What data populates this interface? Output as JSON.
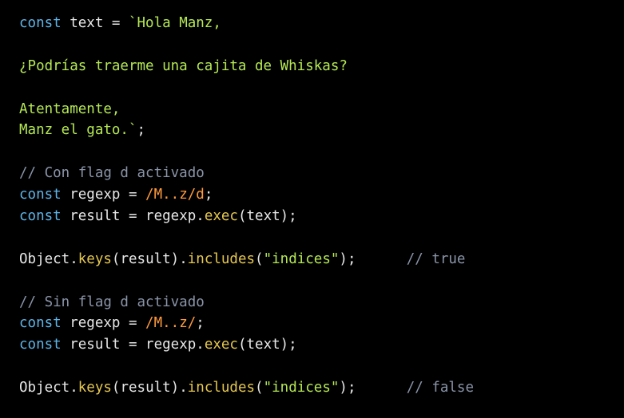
{
  "code": {
    "lines": [
      [
        {
          "t": "const",
          "c": "kw"
        },
        {
          "t": " text = ",
          "c": "id"
        },
        {
          "t": "`Hola Manz,",
          "c": "str"
        }
      ],
      [],
      [
        {
          "t": "¿Podrías traerme una cajita de Whiskas?",
          "c": "str"
        }
      ],
      [],
      [
        {
          "t": "Atentamente,",
          "c": "str"
        }
      ],
      [
        {
          "t": "Manz el gato.`",
          "c": "str"
        },
        {
          "t": ";",
          "c": "id"
        }
      ],
      [],
      [
        {
          "t": "// Con flag d activado",
          "c": "cm"
        }
      ],
      [
        {
          "t": "const",
          "c": "kw"
        },
        {
          "t": " regexp = ",
          "c": "id"
        },
        {
          "t": "/M..z/d",
          "c": "re"
        },
        {
          "t": ";",
          "c": "id"
        }
      ],
      [
        {
          "t": "const",
          "c": "kw"
        },
        {
          "t": " result = regexp.",
          "c": "id"
        },
        {
          "t": "exec",
          "c": "fn"
        },
        {
          "t": "(text);",
          "c": "id"
        }
      ],
      [],
      [
        {
          "t": "Object.",
          "c": "id"
        },
        {
          "t": "keys",
          "c": "fn"
        },
        {
          "t": "(result).",
          "c": "id"
        },
        {
          "t": "includes",
          "c": "fn"
        },
        {
          "t": "(",
          "c": "id"
        },
        {
          "t": "\"indices\"",
          "c": "str"
        },
        {
          "t": ");      ",
          "c": "id"
        },
        {
          "t": "// true",
          "c": "cm"
        }
      ],
      [],
      [
        {
          "t": "// Sin flag d activado",
          "c": "cm"
        }
      ],
      [
        {
          "t": "const",
          "c": "kw"
        },
        {
          "t": " regexp = ",
          "c": "id"
        },
        {
          "t": "/M..z/",
          "c": "re"
        },
        {
          "t": ";",
          "c": "id"
        }
      ],
      [
        {
          "t": "const",
          "c": "kw"
        },
        {
          "t": " result = regexp.",
          "c": "id"
        },
        {
          "t": "exec",
          "c": "fn"
        },
        {
          "t": "(text);",
          "c": "id"
        }
      ],
      [],
      [
        {
          "t": "Object.",
          "c": "id"
        },
        {
          "t": "keys",
          "c": "fn"
        },
        {
          "t": "(result).",
          "c": "id"
        },
        {
          "t": "includes",
          "c": "fn"
        },
        {
          "t": "(",
          "c": "id"
        },
        {
          "t": "\"indices\"",
          "c": "str"
        },
        {
          "t": ");      ",
          "c": "id"
        },
        {
          "t": "// false",
          "c": "cm"
        }
      ]
    ]
  },
  "colors": {
    "background": "#000000",
    "keyword": "#5fb4e8",
    "string": "#b5e853",
    "comment": "#8a94a8",
    "regex": "#ff9a3c",
    "function": "#e6c84f",
    "identifier": "#e8e8e8"
  }
}
